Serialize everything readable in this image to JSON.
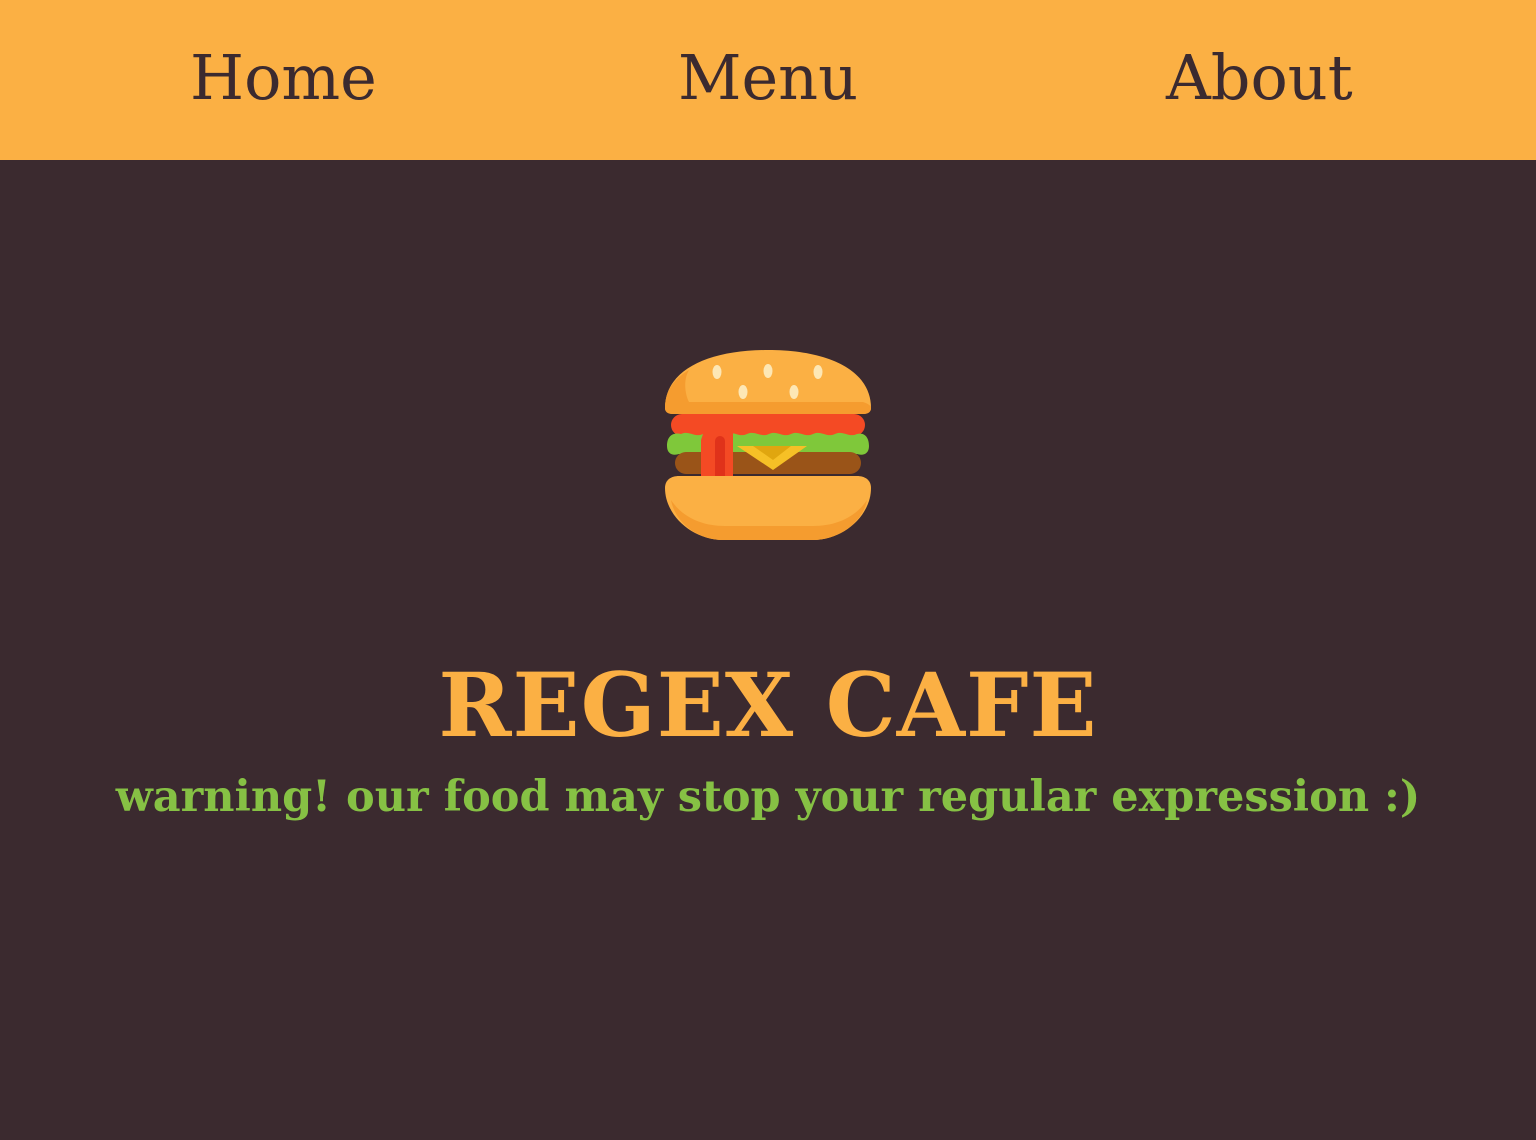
{
  "nav": {
    "home_label": "Home",
    "menu_label": "Menu",
    "about_label": "About"
  },
  "hero": {
    "icon": "burger-icon",
    "title": "REGEX CAFE",
    "tagline": "warning! our food may stop your regular expression :)"
  },
  "colors": {
    "nav_background": "#fbb044",
    "page_background": "#3b2a2f",
    "title": "#fbb044",
    "tagline": "#86c144"
  }
}
